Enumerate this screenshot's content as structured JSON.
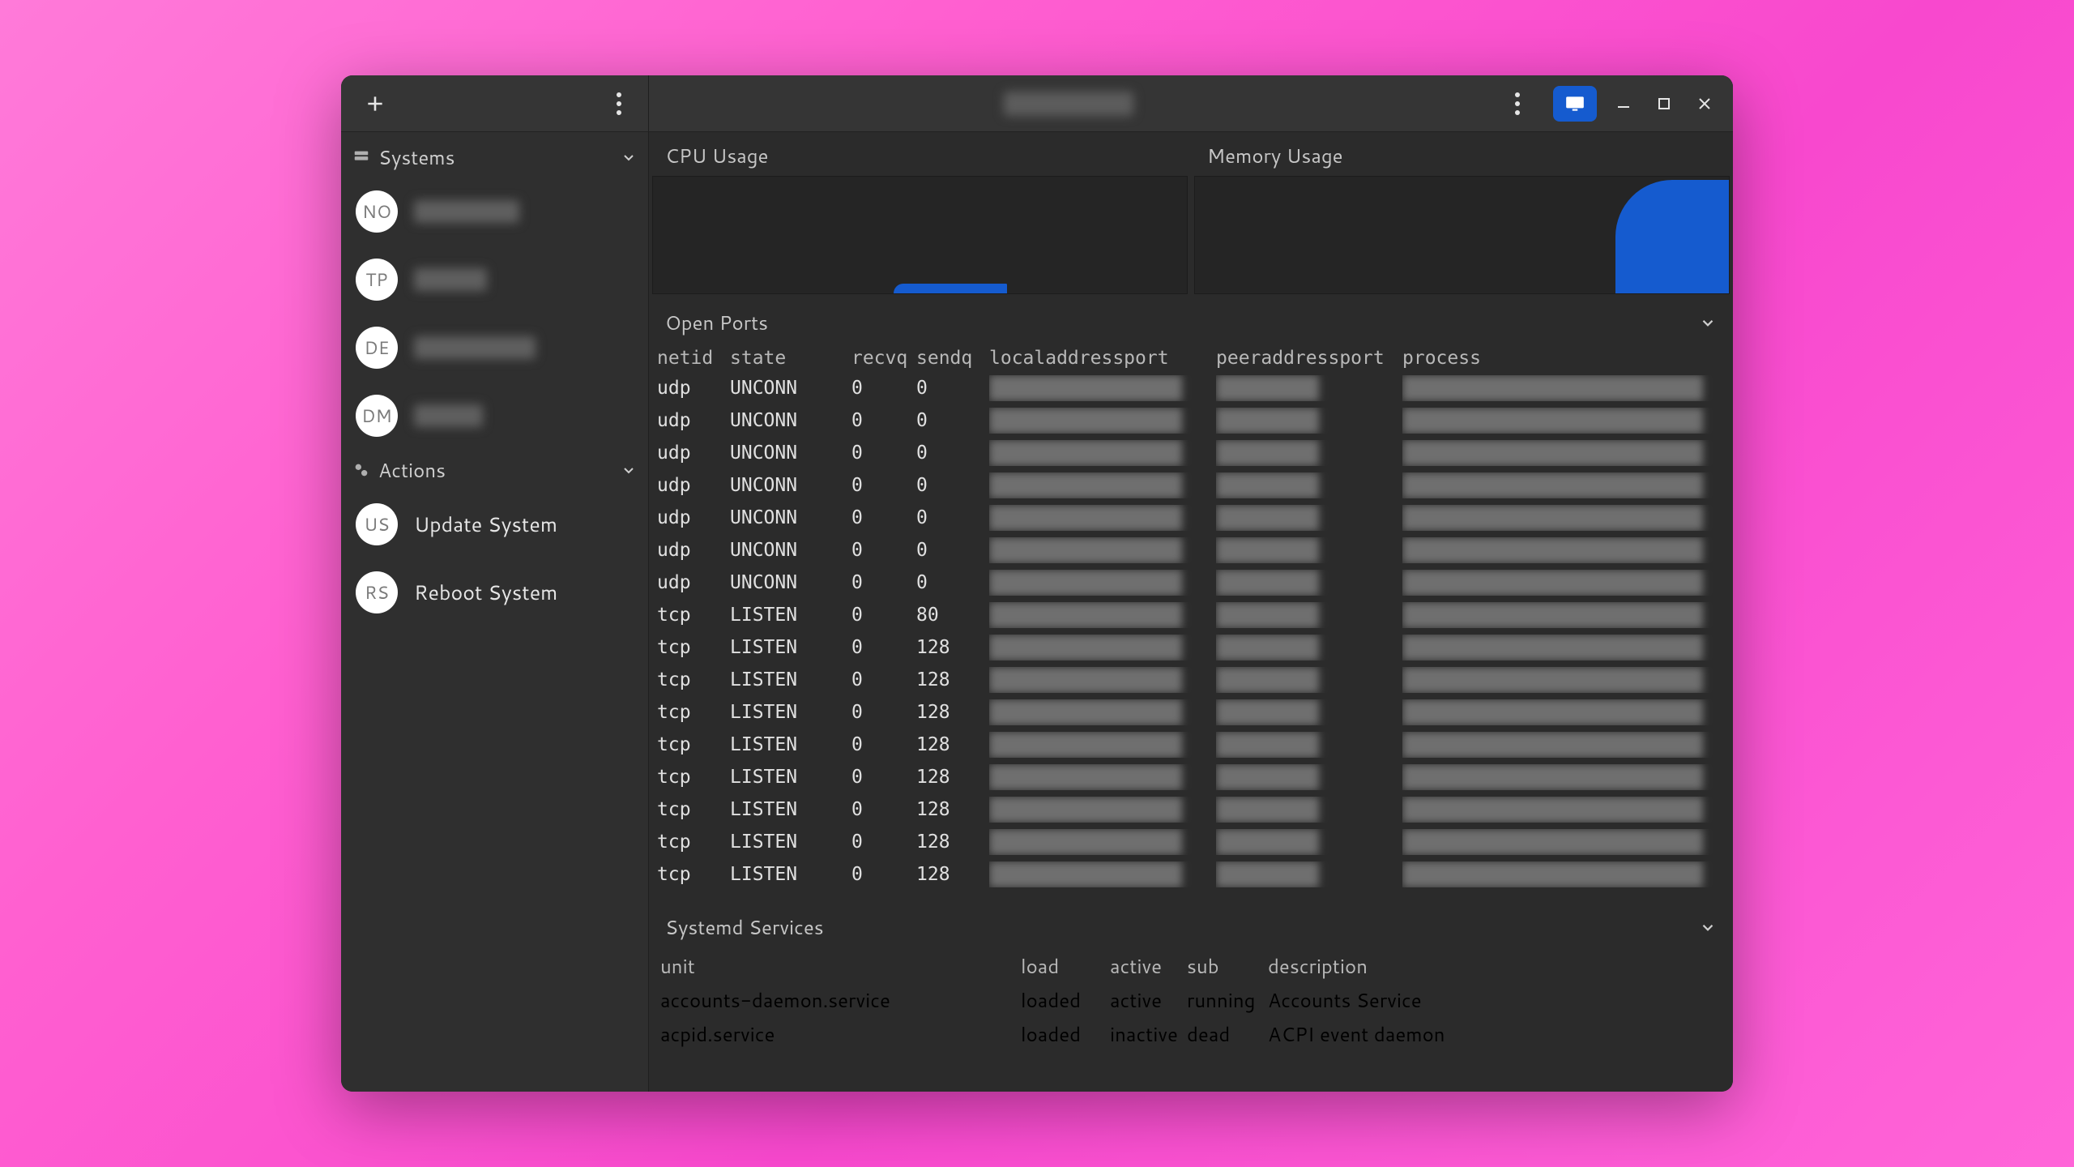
{
  "titlebar": {
    "title_redacted": true
  },
  "sidebar": {
    "sections": {
      "systems": {
        "title": "Systems"
      },
      "actions": {
        "title": "Actions"
      }
    },
    "systems": [
      {
        "initials": "NO",
        "label_redacted": true
      },
      {
        "initials": "TP",
        "label_redacted": true
      },
      {
        "initials": "DE",
        "label_redacted": true
      },
      {
        "initials": "DM",
        "label_redacted": true
      }
    ],
    "actions": [
      {
        "initials": "US",
        "label": "Update System"
      },
      {
        "initials": "RS",
        "label": "Reboot System"
      }
    ]
  },
  "charts": {
    "cpu_title": "CPU Usage",
    "mem_title": "Memory Usage"
  },
  "open_ports": {
    "title": "Open Ports",
    "columns": [
      "netid",
      "state",
      "recvq",
      "sendq",
      "localaddressport",
      "peeraddressport",
      "process"
    ],
    "rows": [
      {
        "netid": "udp",
        "state": "UNCONN",
        "recvq": "0",
        "sendq": "0"
      },
      {
        "netid": "udp",
        "state": "UNCONN",
        "recvq": "0",
        "sendq": "0"
      },
      {
        "netid": "udp",
        "state": "UNCONN",
        "recvq": "0",
        "sendq": "0"
      },
      {
        "netid": "udp",
        "state": "UNCONN",
        "recvq": "0",
        "sendq": "0"
      },
      {
        "netid": "udp",
        "state": "UNCONN",
        "recvq": "0",
        "sendq": "0"
      },
      {
        "netid": "udp",
        "state": "UNCONN",
        "recvq": "0",
        "sendq": "0"
      },
      {
        "netid": "udp",
        "state": "UNCONN",
        "recvq": "0",
        "sendq": "0"
      },
      {
        "netid": "tcp",
        "state": "LISTEN",
        "recvq": "0",
        "sendq": "80"
      },
      {
        "netid": "tcp",
        "state": "LISTEN",
        "recvq": "0",
        "sendq": "128"
      },
      {
        "netid": "tcp",
        "state": "LISTEN",
        "recvq": "0",
        "sendq": "128"
      },
      {
        "netid": "tcp",
        "state": "LISTEN",
        "recvq": "0",
        "sendq": "128"
      },
      {
        "netid": "tcp",
        "state": "LISTEN",
        "recvq": "0",
        "sendq": "128"
      },
      {
        "netid": "tcp",
        "state": "LISTEN",
        "recvq": "0",
        "sendq": "128"
      },
      {
        "netid": "tcp",
        "state": "LISTEN",
        "recvq": "0",
        "sendq": "128"
      },
      {
        "netid": "tcp",
        "state": "LISTEN",
        "recvq": "0",
        "sendq": "128"
      },
      {
        "netid": "tcp",
        "state": "LISTEN",
        "recvq": "0",
        "sendq": "128"
      }
    ]
  },
  "services": {
    "title": "Systemd Services",
    "columns": [
      "unit",
      "load",
      "active",
      "sub",
      "description"
    ],
    "rows": [
      {
        "unit": "accounts-daemon.service",
        "load": "loaded",
        "active": "active",
        "sub": "running",
        "description": "Accounts Service"
      },
      {
        "unit": "acpid.service",
        "load": "loaded",
        "active": "inactive",
        "sub": "dead",
        "description": "ACPI event daemon"
      }
    ]
  },
  "chart_data": [
    {
      "type": "area",
      "title": "CPU Usage",
      "series": [
        {
          "name": "cpu",
          "values": [
            0,
            0,
            0,
            0,
            0,
            0,
            4,
            6,
            4,
            0,
            0,
            0
          ]
        }
      ],
      "ylim": [
        0,
        100
      ]
    },
    {
      "type": "area",
      "title": "Memory Usage",
      "series": [
        {
          "name": "mem",
          "values": [
            0,
            0,
            0,
            0,
            0,
            0,
            0,
            0,
            60,
            95,
            98,
            98
          ]
        }
      ],
      "ylim": [
        0,
        100
      ]
    }
  ]
}
